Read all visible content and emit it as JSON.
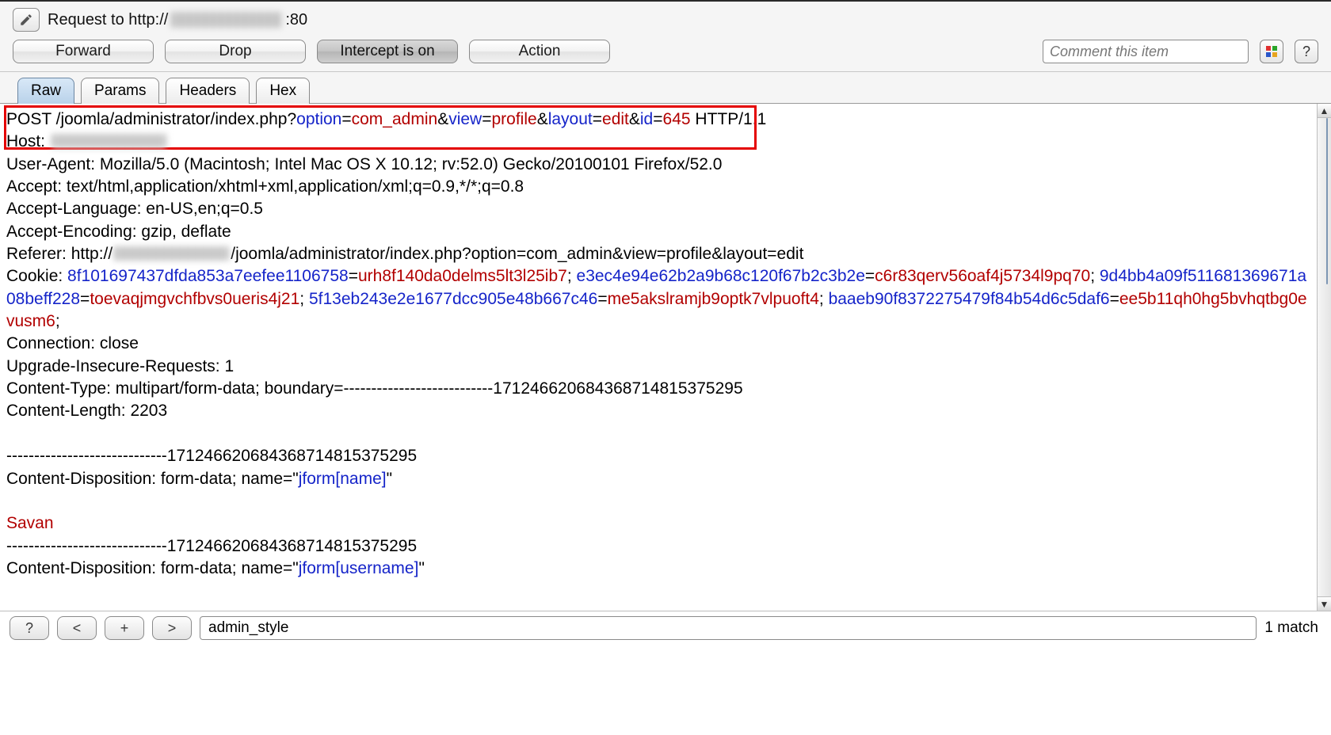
{
  "header": {
    "prefix": "Request to http://",
    "port": ":80"
  },
  "toolbar": {
    "forward": "Forward",
    "drop": "Drop",
    "intercept": "Intercept is on",
    "action": "Action",
    "comment_placeholder": "Comment this item",
    "help_label": "?"
  },
  "tabs": [
    "Raw",
    "Params",
    "Headers",
    "Hex"
  ],
  "request": {
    "method": "POST",
    "path": "/joomla/administrator/index.php?",
    "params": [
      {
        "k": "option",
        "v": "com_admin"
      },
      {
        "k": "view",
        "v": "profile"
      },
      {
        "k": "layout",
        "v": "edit"
      },
      {
        "k": "id",
        "v": "645"
      }
    ],
    "http_version": "HTTP/1.1",
    "host_label": "Host: ",
    "user_agent": "User-Agent: Mozilla/5.0 (Macintosh; Intel Mac OS X 10.12; rv:52.0) Gecko/20100101 Firefox/52.0",
    "accept": "Accept: text/html,application/xhtml+xml,application/xml;q=0.9,*/*;q=0.8",
    "accept_language": "Accept-Language: en-US,en;q=0.5",
    "accept_encoding": "Accept-Encoding: gzip, deflate",
    "referer_prefix": "Referer: http://",
    "referer_suffix": "/joomla/administrator/index.php?option=com_admin&view=profile&layout=edit",
    "cookie_label": "Cookie: ",
    "cookies": [
      {
        "k": "8f101697437dfda853a7eefee1106758",
        "v": "urh8f140da0delms5lt3l25ib7"
      },
      {
        "k": "e3ec4e94e62b2a9b68c120f67b2c3b2e",
        "v": "c6r83qerv56oaf4j5734l9pq70"
      },
      {
        "k": "9d4bb4a09f511681369671a08beff228",
        "v": "toevaqjmgvchfbvs0ueris4j21"
      },
      {
        "k": "5f13eb243e2e1677dcc905e48b667c46",
        "v": "me5akslramjb9optk7vlpuoft4"
      },
      {
        "k": "baaeb90f8372275479f84b54d6c5daf6",
        "v": "ee5b11qh0hg5bvhqtbg0evusm6"
      }
    ],
    "connection": "Connection: close",
    "upgrade": "Upgrade-Insecure-Requests: 1",
    "content_type": "Content-Type: multipart/form-data; boundary=---------------------------171246620684368714815375295",
    "content_length": "Content-Length: 2203",
    "boundary_line": "-----------------------------171246620684368714815375295",
    "cd_prefix": "Content-Disposition: form-data; name=\"",
    "cd_name1": "jform[name]",
    "cd_name2": "jform[username]",
    "cd_quote": "\"",
    "form_value1": "Savan"
  },
  "search": {
    "help": "?",
    "prev": "<",
    "add": "+",
    "next": ">",
    "value": "admin_style",
    "match_count": "1 match"
  }
}
